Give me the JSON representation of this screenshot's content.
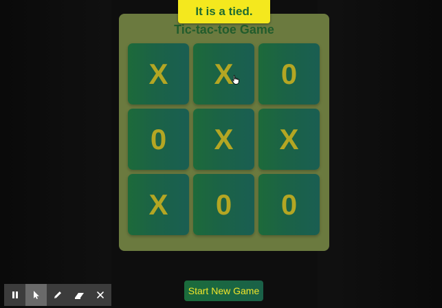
{
  "status_message": "It is a tied.",
  "game": {
    "title": "Tic-tac-toe Game",
    "board": [
      [
        "X",
        "X",
        "0"
      ],
      [
        "0",
        "X",
        "X"
      ],
      [
        "X",
        "0",
        "0"
      ]
    ]
  },
  "new_game_button_label": "Start New Game",
  "toolbar": {
    "tools": [
      {
        "name": "pause-icon",
        "active": false
      },
      {
        "name": "pointer-icon",
        "active": true
      },
      {
        "name": "pen-icon",
        "active": false
      },
      {
        "name": "eraser-icon",
        "active": false
      },
      {
        "name": "close-icon",
        "active": false
      }
    ]
  },
  "colors": {
    "card": "#6b7a3f",
    "cell": "#1b6345",
    "mark": "#b4a623",
    "banner": "#f4e81e",
    "accent_text": "#1e6b30"
  }
}
